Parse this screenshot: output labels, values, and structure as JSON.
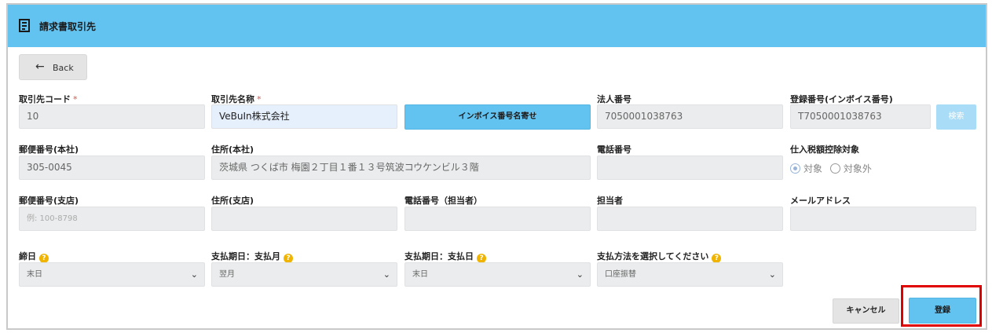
{
  "header": {
    "title": "請求書取引先",
    "icon": "invoice-icon"
  },
  "back_button": {
    "label": "Back",
    "icon": "arrow-left-icon"
  },
  "fields": {
    "partner_code": {
      "label": "取引先コード",
      "required_mark": "*",
      "value": "10"
    },
    "partner_name": {
      "label": "取引先名称",
      "required_mark": "*",
      "value": "VeBuIn株式会社"
    },
    "invoice_lookup_button": {
      "label": "インボイス番号名寄せ"
    },
    "corporate_number": {
      "label": "法人番号",
      "value": "7050001038763"
    },
    "registration_number": {
      "label": "登録番号(インボイス番号)",
      "value": "T7050001038763"
    },
    "search_button": {
      "label": "検索"
    },
    "postal_code_hq": {
      "label": "郵便番号(本社)",
      "value": "305-0045"
    },
    "address_hq": {
      "label": "住所(本社)",
      "value": "茨城県 つくば市 梅園２丁目１番１３号筑波コウケンビル３階"
    },
    "phone": {
      "label": "電話番号",
      "value": ""
    },
    "tax_deduction": {
      "label": "仕入税額控除対象",
      "options": [
        "対象",
        "対象外"
      ],
      "selected": "対象"
    },
    "postal_code_branch": {
      "label": "郵便番号(支店)",
      "placeholder": "例: 100-8798"
    },
    "address_branch": {
      "label": "住所(支店)",
      "value": ""
    },
    "phone_contact": {
      "label": "電話番号（担当者）",
      "value": ""
    },
    "contact_person": {
      "label": "担当者",
      "value": ""
    },
    "email": {
      "label": "メールアドレス",
      "value": ""
    },
    "closing_day": {
      "label": "締日",
      "help": "?",
      "selected": "末日"
    },
    "payment_month": {
      "label": "支払期日：支払月",
      "help": "?",
      "selected": "翌月"
    },
    "payment_day": {
      "label": "支払期日：支払日",
      "help": "?",
      "selected": "末日"
    },
    "payment_method": {
      "label": "支払方法を選択してください",
      "help": "?",
      "selected": "口座振替"
    }
  },
  "footer": {
    "cancel_label": "キャンセル",
    "register_label": "登録"
  },
  "colors": {
    "header": "#63c3f0",
    "highlight": "#e00000",
    "help": "#f0b400"
  }
}
